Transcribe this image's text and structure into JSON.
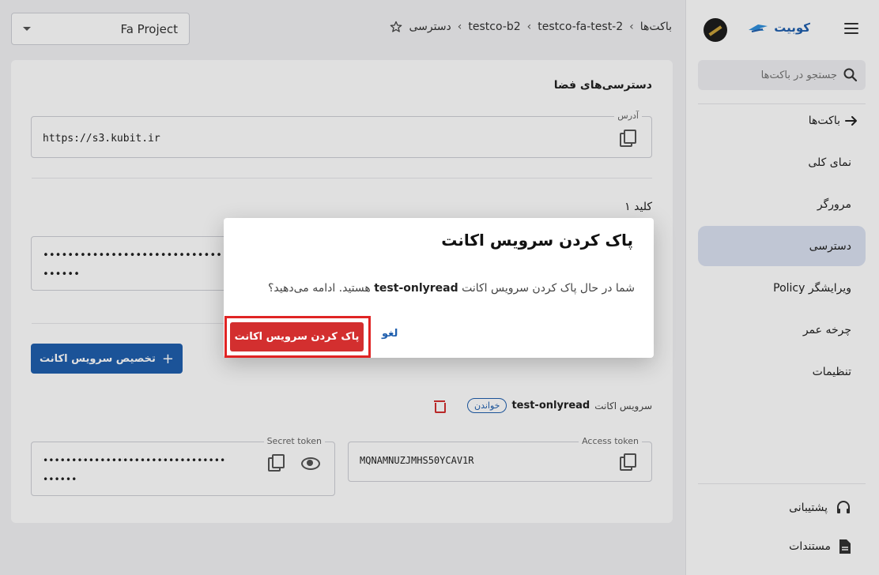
{
  "sidebar": {
    "brand": "کوبیت",
    "search_placeholder": "جستجو در باکت‌ها",
    "back_label": "باکت‌ها",
    "items": [
      {
        "label": "نمای کلی"
      },
      {
        "label": "مرورگر"
      },
      {
        "label": "دسترسی"
      },
      {
        "label": "ویرایشگر Policy"
      },
      {
        "label": "چرخه عمر"
      },
      {
        "label": "تنظیمات"
      }
    ],
    "bottom": [
      {
        "label": "پشتیبانی"
      },
      {
        "label": "مستندات"
      }
    ]
  },
  "topbar": {
    "project": "Fa Project",
    "breadcrumb": [
      "باکت‌ها",
      "testco-fa-test-2",
      "testco-b2",
      "دسترسی"
    ]
  },
  "main": {
    "section_title": "دسترسی‌های فضا",
    "address_label": "آدرس",
    "address_value": "https://s3.kubit.ir",
    "key1_title": "کلید ۱",
    "key1_value_line1": "••••••••••••••••••••••••••••••••",
    "key1_value_line2": "••••••",
    "assign_button": "تخصیص سرویس اکانت",
    "service_account_label": "سرویس اکانت",
    "service_account_name": "test-onlyread",
    "role_chip": "خواندن",
    "access_token_label": "Access token",
    "access_token_value": "MQNAMNUZJMHS50YCAV1R",
    "secret_token_label": "Secret token",
    "secret_line1": "••••••••••••••••••••••••••••••••",
    "secret_line2": "••••••"
  },
  "dialog": {
    "title": "پاک کردن سرویس اکانت",
    "body_prefix": "شما در حال پاک کردن سرویس اکانت",
    "body_name": "test-onlyread",
    "body_suffix": "هستید. ادامه می‌دهید؟",
    "cancel": "لغو",
    "confirm": "پاک کردن سرویس اکانت"
  },
  "colors": {
    "primary": "#1f5fae",
    "danger": "#d32f2f",
    "highlight": "#e02424"
  }
}
